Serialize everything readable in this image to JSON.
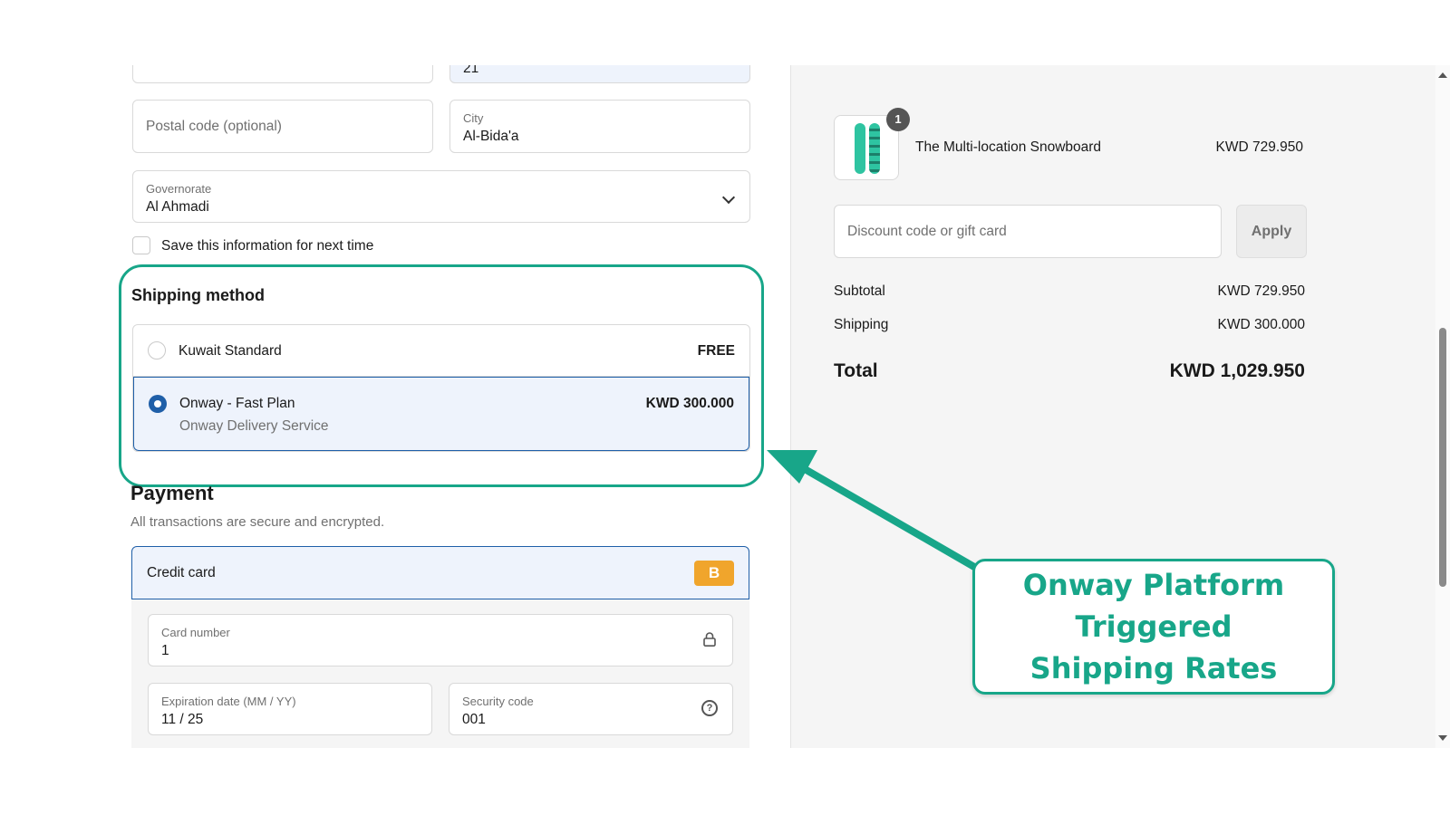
{
  "form": {
    "top_field_left_value": "",
    "top_field_right_value": "21",
    "postal_placeholder": "Postal code (optional)",
    "city_label": "City",
    "city_value": "Al-Bida'a",
    "governorate_label": "Governorate",
    "governorate_value": "Al Ahmadi",
    "save_info_label": "Save this information for next time"
  },
  "shipping": {
    "title": "Shipping method",
    "options": [
      {
        "name": "Kuwait Standard",
        "sub": "",
        "price": "FREE",
        "selected": false
      },
      {
        "name": "Onway - Fast Plan",
        "sub": "Onway Delivery Service",
        "price": "KWD 300.000",
        "selected": true
      }
    ]
  },
  "payment": {
    "title": "Payment",
    "subtitle": "All transactions are secure and encrypted.",
    "method_label": "Credit card",
    "badge": "B",
    "card_number_label": "Card number",
    "card_number_value": "1",
    "expiry_label": "Expiration date (MM / YY)",
    "expiry_value": "11 / 25",
    "security_label": "Security code",
    "security_value": "001",
    "help_glyph": "?"
  },
  "summary": {
    "product_name": "The Multi-location Snowboard",
    "product_price": "KWD 729.950",
    "quantity": "1",
    "discount_placeholder": "Discount code or gift card",
    "apply_label": "Apply",
    "subtotal_label": "Subtotal",
    "subtotal_value": "KWD 729.950",
    "shipping_label": "Shipping",
    "shipping_value": "KWD 300.000",
    "total_label": "Total",
    "total_value": "KWD 1,029.950"
  },
  "annotation": {
    "callout_text": "Onway Platform Triggered Shipping Rates",
    "color": "#18a689"
  },
  "icons": {
    "dropdown": "chevron-down-icon",
    "lock": "lock-icon",
    "help": "help-circle-icon"
  },
  "colors": {
    "accent": "#1f5fa8",
    "badge": "#f0a52c",
    "panel": "#f5f5f5"
  }
}
